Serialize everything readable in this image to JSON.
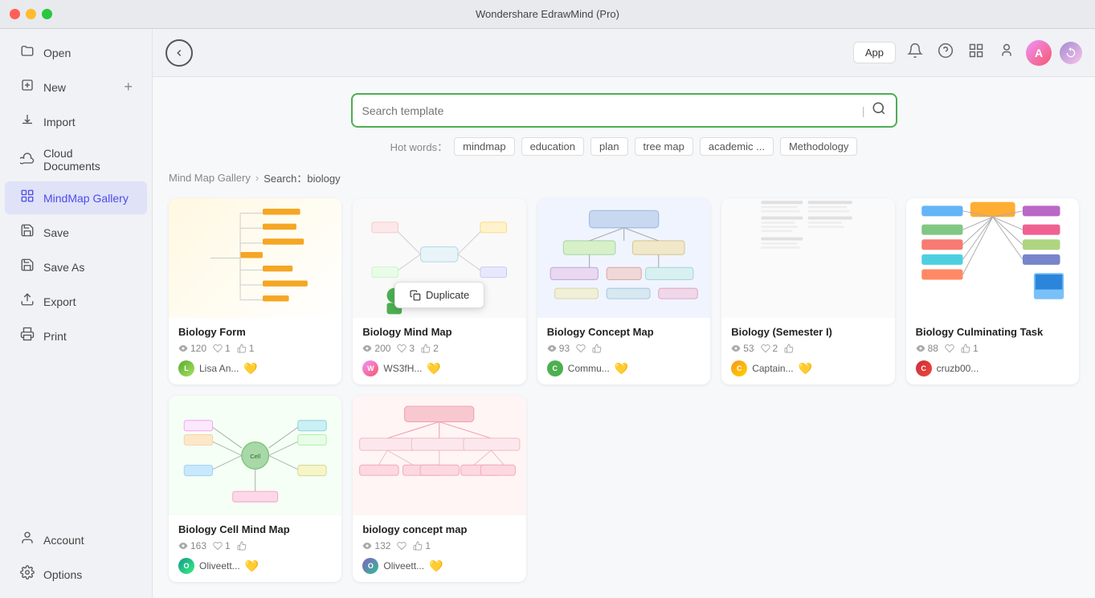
{
  "titlebar": {
    "title": "Wondershare EdrawMind (Pro)"
  },
  "sidebar": {
    "items": [
      {
        "id": "open",
        "label": "Open",
        "icon": "📂"
      },
      {
        "id": "new",
        "label": "New",
        "icon": "📄",
        "has_plus": true
      },
      {
        "id": "import",
        "label": "Import",
        "icon": "📥"
      },
      {
        "id": "cloud",
        "label": "Cloud Documents",
        "icon": "☁️"
      },
      {
        "id": "mindmap-gallery",
        "label": "MindMap Gallery",
        "icon": "🖼️",
        "active": true
      },
      {
        "id": "save",
        "label": "Save",
        "icon": "💾"
      },
      {
        "id": "save-as",
        "label": "Save As",
        "icon": "💾"
      },
      {
        "id": "export",
        "label": "Export",
        "icon": "📤"
      },
      {
        "id": "print",
        "label": "Print",
        "icon": "🖨️"
      }
    ],
    "bottom": [
      {
        "id": "account",
        "label": "Account",
        "icon": "👤"
      },
      {
        "id": "options",
        "label": "Options",
        "icon": "⚙️"
      }
    ]
  },
  "topbar": {
    "app_label": "App"
  },
  "search": {
    "placeholder": "Search template",
    "hot_words_label": "Hot words：",
    "tags": [
      "mindmap",
      "education",
      "plan",
      "tree map",
      "academic ...",
      "Methodology"
    ]
  },
  "breadcrumb": {
    "parent": "Mind Map Gallery",
    "separator": ">",
    "current": "Search：biology"
  },
  "gallery": {
    "cards": [
      {
        "id": "biology-form",
        "title": "Biology Form",
        "views": "120",
        "likes": "1",
        "thumbs_up": "1",
        "author": "Lisa An...",
        "pro": true,
        "thumb_style": "form"
      },
      {
        "id": "biology-mind-map",
        "title": "Biology Mind Map",
        "views": "200",
        "likes": "3",
        "thumbs_up": "2",
        "author": "WS3fH...",
        "pro": true,
        "thumb_style": "mind",
        "has_duplicate": true,
        "duplicate_label": "Duplicate"
      },
      {
        "id": "biology-concept-map",
        "title": "Biology Concept Map",
        "views": "93",
        "likes": "",
        "thumbs_up": "",
        "author": "Commu...",
        "pro": true,
        "thumb_style": "concept"
      },
      {
        "id": "biology-semester",
        "title": "Biology (Semester I)",
        "views": "53",
        "likes": "2",
        "thumbs_up": "",
        "author": "Captain...",
        "pro": true,
        "thumb_style": "semester"
      },
      {
        "id": "biology-culminating",
        "title": "Biology Culminating Task",
        "views": "88",
        "likes": "",
        "thumbs_up": "1",
        "author": "cruzb00...",
        "pro": false,
        "thumb_style": "culminating"
      },
      {
        "id": "biology-cell-mind",
        "title": "Biology Cell Mind Map",
        "views": "163",
        "likes": "1",
        "thumbs_up": "",
        "author": "Oliveett...",
        "pro": true,
        "thumb_style": "cell"
      },
      {
        "id": "biology-concept2",
        "title": "biology concept map",
        "views": "132",
        "likes": "",
        "thumbs_up": "1",
        "author": "Oliveett...",
        "pro": true,
        "thumb_style": "concept2"
      }
    ]
  }
}
